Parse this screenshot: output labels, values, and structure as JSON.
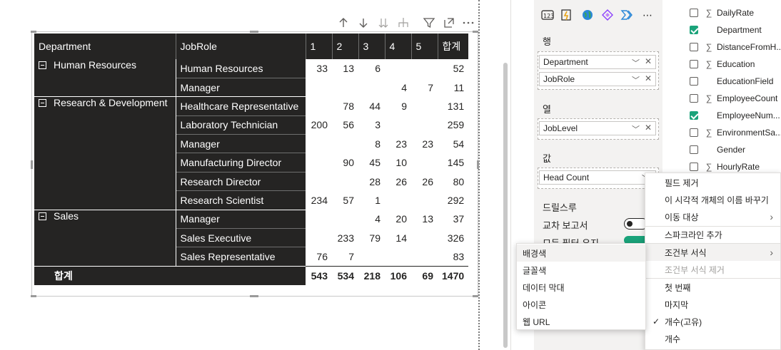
{
  "visual_toolbar": {
    "icons": [
      "arrow-up-icon",
      "arrow-down-icon",
      "double-arrow-down-icon",
      "expand-hierarchy-icon",
      "filter-icon",
      "focus-mode-icon",
      "more-options-icon"
    ]
  },
  "matrix": {
    "headers": [
      "Department",
      "JobRole",
      "1",
      "2",
      "3",
      "4",
      "5",
      "합계"
    ],
    "groups": [
      {
        "department": "Human Resources",
        "rows": [
          {
            "role": "Human Resources",
            "values": [
              "33",
              "13",
              "6",
              "",
              ""
            ],
            "total": "52"
          },
          {
            "role": "Manager",
            "values": [
              "",
              "",
              "",
              "4",
              "7"
            ],
            "total": "11"
          }
        ]
      },
      {
        "department": "Research & Development",
        "rows": [
          {
            "role": "Healthcare Representative",
            "values": [
              "",
              "78",
              "44",
              "9",
              ""
            ],
            "total": "131"
          },
          {
            "role": "Laboratory Technician",
            "values": [
              "200",
              "56",
              "3",
              "",
              ""
            ],
            "total": "259"
          },
          {
            "role": "Manager",
            "values": [
              "",
              "",
              "8",
              "23",
              "23"
            ],
            "total": "54"
          },
          {
            "role": "Manufacturing Director",
            "values": [
              "",
              "90",
              "45",
              "10",
              ""
            ],
            "total": "145"
          },
          {
            "role": "Research Director",
            "values": [
              "",
              "",
              "28",
              "26",
              "26"
            ],
            "total": "80"
          },
          {
            "role": "Research Scientist",
            "values": [
              "234",
              "57",
              "1",
              "",
              ""
            ],
            "total": "292"
          }
        ]
      },
      {
        "department": "Sales",
        "rows": [
          {
            "role": "Manager",
            "values": [
              "",
              "",
              "4",
              "20",
              "13"
            ],
            "total": "37"
          },
          {
            "role": "Sales Executive",
            "values": [
              "",
              "233",
              "79",
              "14",
              ""
            ],
            "total": "326"
          },
          {
            "role": "Sales Representative",
            "values": [
              "76",
              "7",
              "",
              "",
              ""
            ],
            "total": "83"
          }
        ]
      }
    ],
    "grand_total": {
      "label": "합계",
      "values": [
        "543",
        "534",
        "218",
        "106",
        "69"
      ],
      "total": "1470"
    }
  },
  "build_pane": {
    "rows_label": "행",
    "rows_fields": [
      "Department",
      "JobRole"
    ],
    "columns_label": "열",
    "columns_fields": [
      "JobLevel"
    ],
    "values_label": "값",
    "values_fields": [
      "Head Count"
    ],
    "drillthrough_label": "드릴스루",
    "cross_report_label": "교차 보고서",
    "keep_filters_label": "모든 필터 유지"
  },
  "fields_list": [
    {
      "name": "DailyRate",
      "checked": false,
      "sigma": true
    },
    {
      "name": "Department",
      "checked": true,
      "sigma": false
    },
    {
      "name": "DistanceFromH...",
      "checked": false,
      "sigma": true
    },
    {
      "name": "Education",
      "checked": false,
      "sigma": true
    },
    {
      "name": "EducationField",
      "checked": false,
      "sigma": false
    },
    {
      "name": "EmployeeCount",
      "checked": false,
      "sigma": true
    },
    {
      "name": "EmployeeNum...",
      "checked": true,
      "sigma": false
    },
    {
      "name": "EnvironmentSa...",
      "checked": false,
      "sigma": true
    },
    {
      "name": "Gender",
      "checked": false,
      "sigma": false
    },
    {
      "name": "HourlyRate",
      "checked": false,
      "sigma": true
    }
  ],
  "context_menu": {
    "items": [
      {
        "label": "필드 제거"
      },
      {
        "label": "이 시각적 개체의 이름 바꾸기"
      },
      {
        "label": "이동 대상",
        "submenu": true
      },
      {
        "label": "스파크라인 추가"
      },
      {
        "label": "조건부 서식",
        "submenu": true
      },
      {
        "label": "조건부 서식 제거",
        "disabled": true
      },
      {
        "label": "첫 번째"
      },
      {
        "label": "마지막"
      },
      {
        "label": "개수(고유)",
        "checked": true
      },
      {
        "label": "개수"
      }
    ]
  },
  "submenu": {
    "items": [
      "배경색",
      "글꼴색",
      "데이터 막대",
      "아이콘",
      "웹 URL"
    ]
  }
}
